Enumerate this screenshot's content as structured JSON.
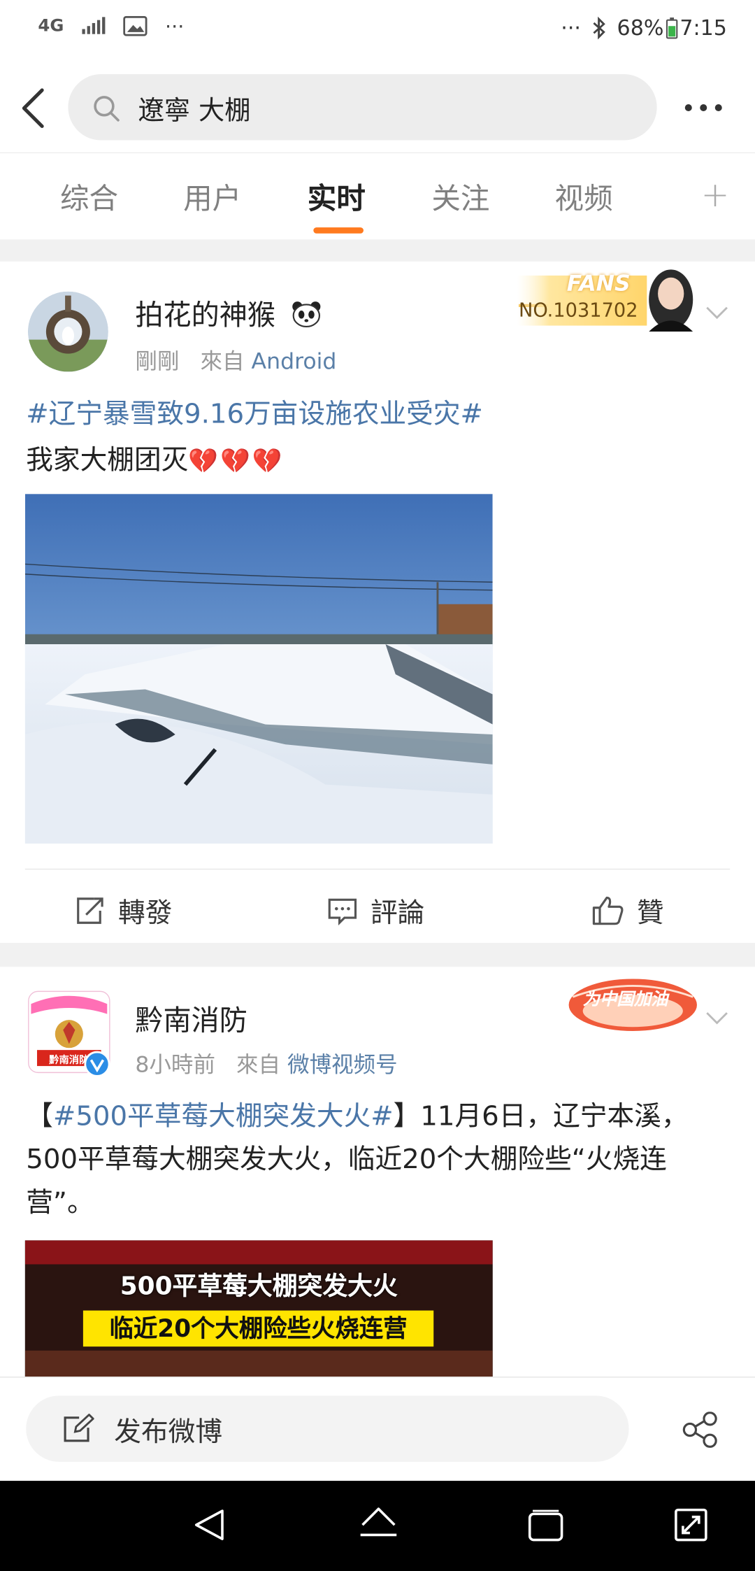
{
  "status_bar": {
    "network": "4G",
    "dots_left": "···",
    "dots_right": "···",
    "battery": "68%",
    "time": "7:15"
  },
  "search": {
    "query": "遼寧 大棚"
  },
  "tabs": [
    {
      "label": "综合",
      "active": false
    },
    {
      "label": "用户",
      "active": false
    },
    {
      "label": "实时",
      "active": true
    },
    {
      "label": "关注",
      "active": false
    },
    {
      "label": "视频",
      "active": false
    }
  ],
  "tab_add": "+",
  "posts": [
    {
      "username": "拍花的神猴",
      "time": "剛剛",
      "from_label": "來自",
      "source": "Android",
      "badge": {
        "title": "FANS",
        "number": "NO.1031702"
      },
      "hashtag": "#辽宁暴雪致9.16万亩设施农业受灾#",
      "text": "我家大棚团灭",
      "emoji": "💔💔💔",
      "actions": {
        "repost": "轉發",
        "comment": "評論",
        "like": "贊"
      }
    },
    {
      "username": "黔南消防",
      "avatar_text": "黔南消防",
      "time": "8小時前",
      "from_label": "來自",
      "source": "微博视频号",
      "badge": {
        "text": "为中国加油"
      },
      "bracket_open": "【",
      "hashtag": "#500平草莓大棚突发大火#",
      "bracket_close": "】",
      "text": "11月6日，辽宁本溪，500平草莓大棚突发大火，临近20个大棚险些“火烧连营”。",
      "video_caption_1": "500平草莓大棚突发大火",
      "video_caption_2": "临近20个大棚险些火烧连营"
    }
  ],
  "compose": {
    "label": "发布微博"
  },
  "colors": {
    "accent": "#ff7a1f",
    "link": "#4a76a8",
    "source": "#5b80a8"
  }
}
